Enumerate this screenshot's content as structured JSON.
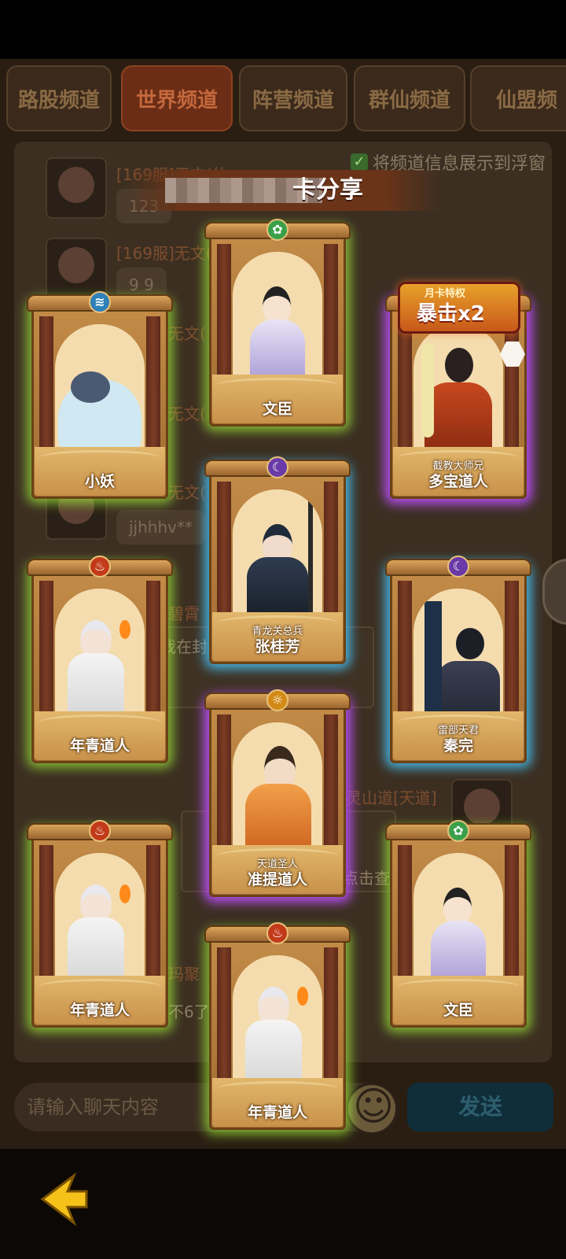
{
  "tabs": [
    "路股频道",
    "世界频道",
    "阵营频道",
    "群仙频道",
    "仙盟频"
  ],
  "active_tab": 1,
  "float_option": "将频道信息展示到浮窗",
  "chat": [
    {
      "name": "[169服]无文(仙",
      "msg": "123"
    },
    {
      "name": "[169服]无文(",
      "msg": "9 9"
    },
    {
      "name": "无文(",
      "msg": ""
    },
    {
      "name": "无文(",
      "msg": ""
    },
    {
      "name": "无文(",
      "msg": "jjhhhv**"
    }
  ],
  "behind_texts": [
    "碧霄",
    "我在封",
    "灵山道[天道]",
    "点击查看",
    "玛聚",
    "不6了"
  ],
  "share": {
    "title_suffix": "卡分享"
  },
  "cards": [
    {
      "name": "文臣",
      "sub": ""
    },
    {
      "name": "小妖",
      "sub": ""
    },
    {
      "name": "多宝道人",
      "sub": "截教大师兄"
    },
    {
      "name": "张桂芳",
      "sub": "青龙关总兵"
    },
    {
      "name": "年青道人",
      "sub": ""
    },
    {
      "name": "秦完",
      "sub": "雷部天君"
    },
    {
      "name": "准提道人",
      "sub": "天道圣人"
    },
    {
      "name": "年青道人",
      "sub": ""
    },
    {
      "name": "文臣",
      "sub": ""
    },
    {
      "name": "年青道人",
      "sub": ""
    }
  ],
  "badge": {
    "top": "月卡特权",
    "main": "暴击x2"
  },
  "input": {
    "placeholder": "请输入聊天内容"
  },
  "send_label": "发送",
  "icons": [
    "check-icon",
    "emoji-icon",
    "back-arrow-icon",
    "element-icon",
    "hexagon-icon"
  ]
}
